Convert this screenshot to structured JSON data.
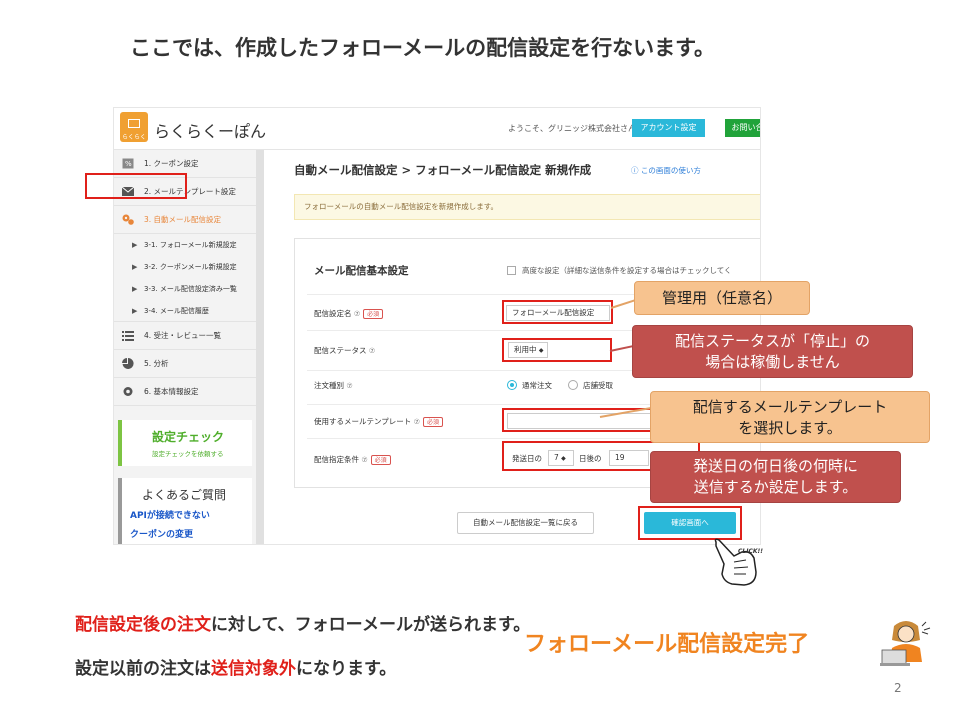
{
  "slide": {
    "title": "ここでは、作成したフォローメールの配信設定を行ないます。",
    "bottom_line1_em": "配信設定後の注文",
    "bottom_line1_rest": "に対して、フォローメールが送られます。",
    "bottom_line2_pre": "設定以前の注文は",
    "bottom_line2_em": "送信対象外",
    "bottom_line2_post": "になります。",
    "completion": "フォローメール配信設定完了",
    "page_number": "2",
    "click_label": "CLICK!!"
  },
  "app": {
    "logo_mark_text": "らくらく",
    "logo_text": "らくらくーぽん",
    "welcome": "ようこそ、グリニッジ株式会社さん",
    "account_button": "アカウント設定",
    "contact_button": "お問い合"
  },
  "sidebar": {
    "items": [
      {
        "label": "1. クーポン設定",
        "icon": "coupon-icon"
      },
      {
        "label": "2. メールテンプレート設定",
        "icon": "envelope-icon"
      },
      {
        "label": "3. 自動メール配信設定",
        "icon": "gears-icon"
      },
      {
        "label": "4. 受注・レビュー一覧",
        "icon": "list-icon"
      },
      {
        "label": "5. 分析",
        "icon": "pie-chart-icon"
      },
      {
        "label": "6. 基本情報設定",
        "icon": "gear-icon"
      }
    ],
    "sub_items": [
      "3-1. フォローメール新規設定",
      "3-2. クーポンメール新規設定",
      "3-3. メール配信設定済み一覧",
      "3-4. メール配信履歴"
    ],
    "check_title": "設定チェック",
    "check_sub": "設定チェックを依頼する",
    "faq_title": "よくあるご質問",
    "faq_links": [
      "APIが接続できない",
      "クーポンの変更"
    ]
  },
  "main": {
    "breadcrumb": "自動メール配信設定 > フォローメール配信設定 新規作成",
    "help_link": "この画面の使い方",
    "notice": "フォローメールの自動メール配信設定を新規作成します。",
    "form_title": "メール配信基本設定",
    "advanced_label": "高度な設定（詳細な送信条件を設定する場合はチェックしてく",
    "required_badge": "必須",
    "fields": {
      "name_label": "配信設定名",
      "name_value": "フォローメール配信設定",
      "status_label": "配信ステータス",
      "status_value": "利用中",
      "order_type_label": "注文種別",
      "order_type_option1": "通常注文",
      "order_type_option2": "店舗受取",
      "template_label": "使用するメールテンプレート",
      "condition_label": "配信指定条件",
      "condition_prefix": "発送日の",
      "condition_days": "7",
      "condition_mid": "日後の",
      "condition_hour": "19"
    },
    "back_button": "自動メール配信設定一覧に戻る",
    "confirm_button": "確認画面へ"
  },
  "callouts": {
    "c1": "管理用（任意名）",
    "c2_line1": "配信ステータスが「停止」の",
    "c2_line2": "場合は稼働しません",
    "c3_line1": "配信するメールテンプレート",
    "c3_line2": "を選択します。",
    "c4_line1": "発送日の何日後の何時に",
    "c4_line2": "送信するか設定します。"
  },
  "colors": {
    "accent": "#2ab8d9",
    "highlight_red": "#e0201a",
    "callout_orange": "#f7c38f",
    "callout_red": "#c0504d",
    "completion_orange": "#f08420",
    "check_green": "#4fae2b"
  }
}
